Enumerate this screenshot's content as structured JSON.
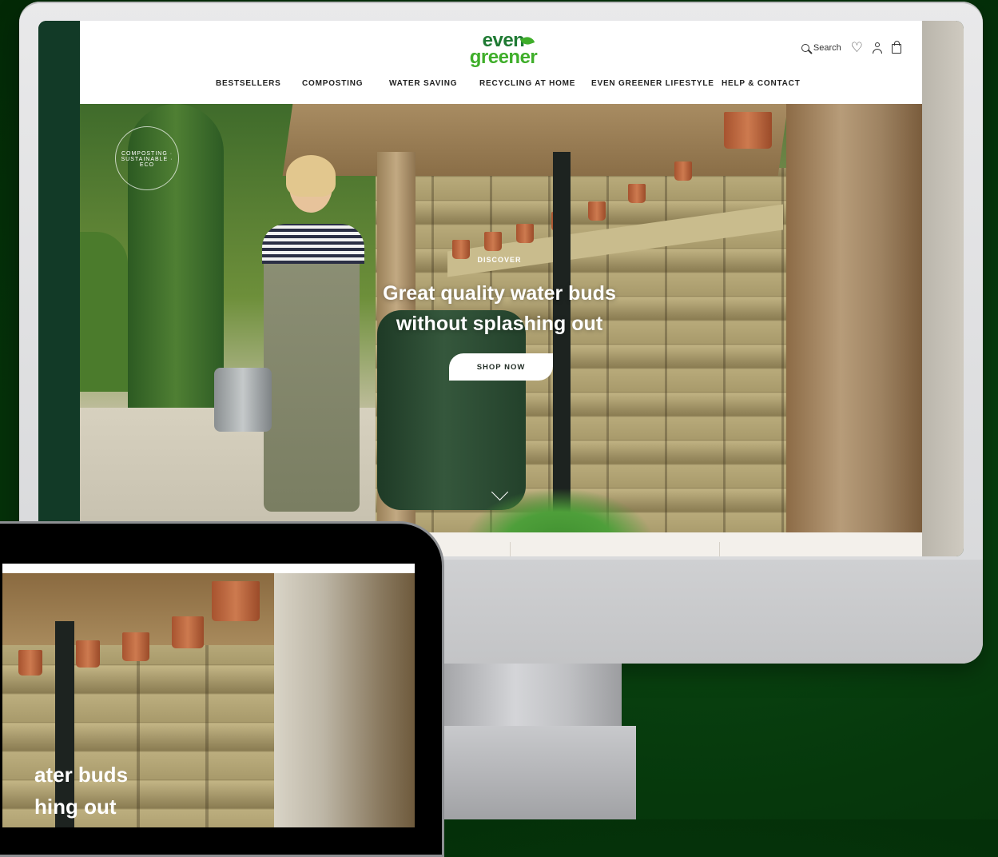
{
  "desktop": {
    "logo": {
      "line1": "even",
      "line2": "greener"
    },
    "header": {
      "search_label": "Search"
    },
    "nav": [
      {
        "label": "BESTSELLERS"
      },
      {
        "label": "COMPOSTING"
      },
      {
        "label": "WATER SAVING"
      },
      {
        "label": "RECYCLING AT HOME"
      },
      {
        "label": "EVEN GREENER LIFESTYLE"
      },
      {
        "label": "HELP & CONTACT"
      }
    ],
    "hero": {
      "badge_text": "COMPOSTING · SUSTAINABLE · ECO",
      "eyebrow": "DISCOVER",
      "headline_line1": "Great quality water buds",
      "headline_line2": "without splashing out",
      "cta_label": "SHOP NOW"
    }
  },
  "laptop": {
    "headline_line1": "ater buds",
    "headline_line2": "hing out"
  },
  "colors": {
    "background": "#06380c",
    "brand_green": "#1f7a33",
    "brand_light_green": "#3fae2a",
    "sidebar_dark": "#123a27"
  },
  "icons": [
    "search-icon",
    "heart-icon",
    "user-icon",
    "bag-icon",
    "chevron-down-icon"
  ]
}
